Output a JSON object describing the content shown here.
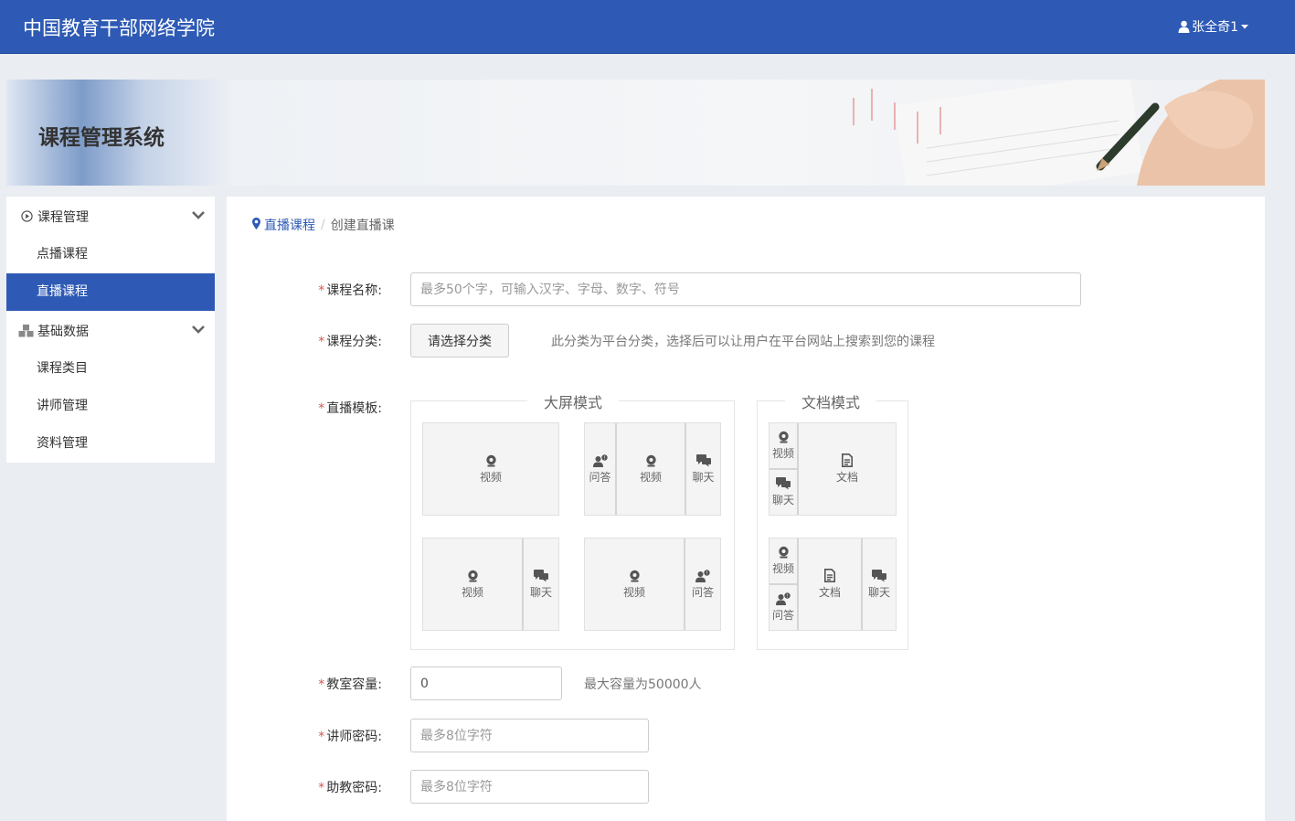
{
  "header": {
    "brand": "中国教育干部网络学院",
    "user_name": "张全奇1"
  },
  "banner": {
    "title": "课程管理系统"
  },
  "sidebar": {
    "groups": [
      {
        "label": "课程管理",
        "items": [
          {
            "label": "点播课程"
          },
          {
            "label": "直播课程",
            "active": true
          }
        ]
      },
      {
        "label": "基础数据",
        "items": [
          {
            "label": "课程类目"
          },
          {
            "label": "讲师管理"
          },
          {
            "label": "资料管理"
          }
        ]
      }
    ]
  },
  "breadcrumb": {
    "parent": "直播课程",
    "separator": "/",
    "current": "创建直播课"
  },
  "form": {
    "required_mark": "*",
    "course_name": {
      "label": "课程名称:",
      "placeholder": "最多50个字，可输入汉字、字母、数字、符号"
    },
    "category": {
      "label": "课程分类:",
      "button": "请选择分类",
      "hint": "此分类为平台分类，选择后可以让用户在平台网站上搜索到您的课程"
    },
    "template": {
      "label": "直播模板:",
      "big_screen_legend": "大屏模式",
      "document_legend": "文档模式",
      "cells": {
        "video": "视频",
        "qa": "问答",
        "chat": "聊天",
        "doc": "文档"
      }
    },
    "capacity": {
      "label": "教室容量:",
      "value": "0",
      "hint": "最大容量为50000人"
    },
    "teacher_password": {
      "label": "讲师密码:",
      "placeholder": "最多8位字符"
    },
    "assistant_password": {
      "label": "助教密码:",
      "placeholder": "最多8位字符"
    }
  },
  "colors": {
    "primary": "#2e5ab5",
    "required": "#d9534f",
    "background": "#eaedf1"
  }
}
